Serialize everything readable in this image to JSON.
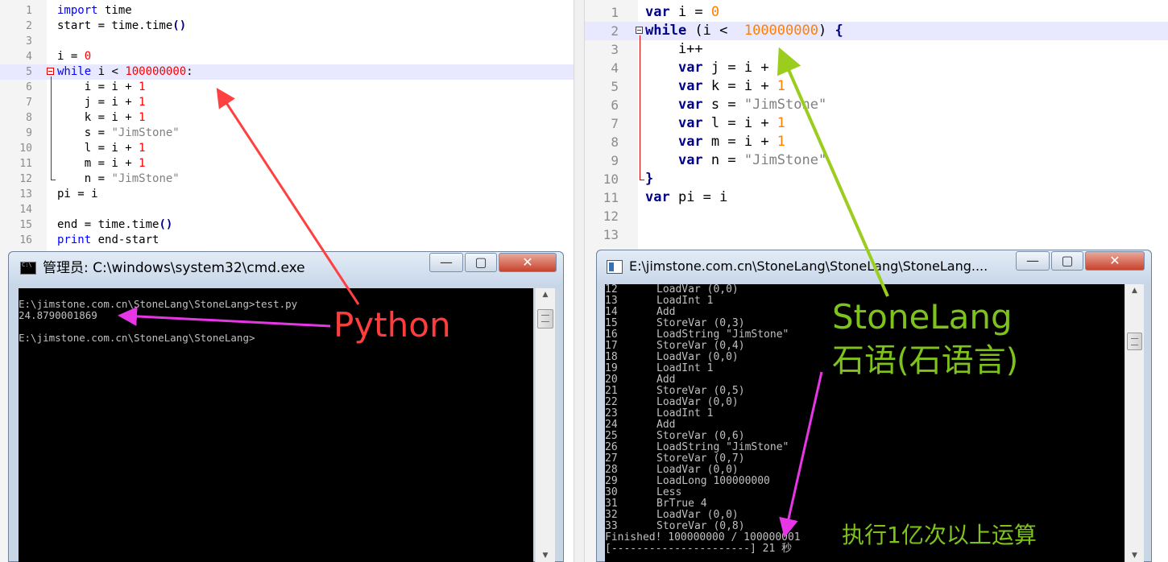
{
  "colors": {
    "python_label": "#ff3d3d",
    "stonelang_label": "#7ec21c",
    "magenta_arrow": "#e636e6",
    "green_arrow": "#9acd1e",
    "red_arrow": "#ff4040",
    "current_line_highlight": "#e8e8ff"
  },
  "python_editor": {
    "lines": [
      {
        "num": "1",
        "tokens": [
          {
            "t": "import",
            "c": "kw"
          },
          {
            "t": " time",
            "c": "plain"
          }
        ]
      },
      {
        "num": "2",
        "tokens": [
          {
            "t": "start = time.time",
            "c": "plain"
          },
          {
            "t": "()",
            "c": "op"
          }
        ]
      },
      {
        "num": "3",
        "tokens": []
      },
      {
        "num": "4",
        "tokens": [
          {
            "t": "i = ",
            "c": "plain"
          },
          {
            "t": "0",
            "c": "num"
          }
        ]
      },
      {
        "num": "5",
        "tokens": [
          {
            "t": "while",
            "c": "kw"
          },
          {
            "t": " i < ",
            "c": "plain"
          },
          {
            "t": "100000000",
            "c": "num"
          },
          {
            "t": ":",
            "c": "plain"
          }
        ]
      },
      {
        "num": "6",
        "tokens": [
          {
            "t": "    i = i + ",
            "c": "plain"
          },
          {
            "t": "1",
            "c": "num"
          }
        ]
      },
      {
        "num": "7",
        "tokens": [
          {
            "t": "    j = i + ",
            "c": "plain"
          },
          {
            "t": "1",
            "c": "num"
          }
        ]
      },
      {
        "num": "8",
        "tokens": [
          {
            "t": "    k = i + ",
            "c": "plain"
          },
          {
            "t": "1",
            "c": "num"
          }
        ]
      },
      {
        "num": "9",
        "tokens": [
          {
            "t": "    s = ",
            "c": "plain"
          },
          {
            "t": "\"JimStone\"",
            "c": "str"
          }
        ]
      },
      {
        "num": "10",
        "tokens": [
          {
            "t": "    l = i + ",
            "c": "plain"
          },
          {
            "t": "1",
            "c": "num"
          }
        ]
      },
      {
        "num": "11",
        "tokens": [
          {
            "t": "    m = i + ",
            "c": "plain"
          },
          {
            "t": "1",
            "c": "num"
          }
        ]
      },
      {
        "num": "12",
        "tokens": [
          {
            "t": "    n = ",
            "c": "plain"
          },
          {
            "t": "\"JimStone\"",
            "c": "str"
          }
        ]
      },
      {
        "num": "13",
        "tokens": [
          {
            "t": "pi = i",
            "c": "plain"
          }
        ]
      },
      {
        "num": "14",
        "tokens": []
      },
      {
        "num": "15",
        "tokens": [
          {
            "t": "end = time.time",
            "c": "plain"
          },
          {
            "t": "()",
            "c": "op"
          }
        ]
      },
      {
        "num": "16",
        "tokens": [
          {
            "t": "print",
            "c": "kw"
          },
          {
            "t": " end-start",
            "c": "plain"
          }
        ]
      }
    ]
  },
  "stonelang_editor": {
    "lines": [
      {
        "num": "1",
        "tokens": [
          {
            "t": "var",
            "c": "kwb"
          },
          {
            "t": " i = ",
            "c": "plain"
          },
          {
            "t": "0",
            "c": "numo"
          }
        ]
      },
      {
        "num": "2",
        "tokens": [
          {
            "t": "while",
            "c": "kwb"
          },
          {
            "t": " (i <  ",
            "c": "plain"
          },
          {
            "t": "100000000",
            "c": "numo"
          },
          {
            "t": ") ",
            "c": "plain"
          },
          {
            "t": "{",
            "c": "op"
          }
        ]
      },
      {
        "num": "3",
        "tokens": [
          {
            "t": "    i++",
            "c": "plain"
          }
        ]
      },
      {
        "num": "4",
        "tokens": [
          {
            "t": "    ",
            "c": "plain"
          },
          {
            "t": "var",
            "c": "kwb"
          },
          {
            "t": " j = i + ",
            "c": "plain"
          },
          {
            "t": "1",
            "c": "numo"
          }
        ]
      },
      {
        "num": "5",
        "tokens": [
          {
            "t": "    ",
            "c": "plain"
          },
          {
            "t": "var",
            "c": "kwb"
          },
          {
            "t": " k = i + ",
            "c": "plain"
          },
          {
            "t": "1",
            "c": "numo"
          }
        ]
      },
      {
        "num": "6",
        "tokens": [
          {
            "t": "    ",
            "c": "plain"
          },
          {
            "t": "var",
            "c": "kwb"
          },
          {
            "t": " s = ",
            "c": "plain"
          },
          {
            "t": "\"JimStone\"",
            "c": "str"
          }
        ]
      },
      {
        "num": "7",
        "tokens": [
          {
            "t": "    ",
            "c": "plain"
          },
          {
            "t": "var",
            "c": "kwb"
          },
          {
            "t": " l = i + ",
            "c": "plain"
          },
          {
            "t": "1",
            "c": "numo"
          }
        ]
      },
      {
        "num": "8",
        "tokens": [
          {
            "t": "    ",
            "c": "plain"
          },
          {
            "t": "var",
            "c": "kwb"
          },
          {
            "t": " m = i + ",
            "c": "plain"
          },
          {
            "t": "1",
            "c": "numo"
          }
        ]
      },
      {
        "num": "9",
        "tokens": [
          {
            "t": "    ",
            "c": "plain"
          },
          {
            "t": "var",
            "c": "kwb"
          },
          {
            "t": " n = ",
            "c": "plain"
          },
          {
            "t": "\"JimStone\"",
            "c": "str"
          }
        ]
      },
      {
        "num": "10",
        "tokens": [
          {
            "t": "}",
            "c": "op"
          }
        ]
      },
      {
        "num": "11",
        "tokens": [
          {
            "t": "var",
            "c": "kwb"
          },
          {
            "t": " pi = i",
            "c": "plain"
          }
        ]
      },
      {
        "num": "12",
        "tokens": []
      },
      {
        "num": "13",
        "tokens": []
      }
    ]
  },
  "cmd_window": {
    "title": "管理员: C:\\windows\\system32\\cmd.exe",
    "minimize_label": "—",
    "maximize_label": "▢",
    "close_label": "✕",
    "output": [
      "E:\\jimstone.com.cn\\StoneLang\\StoneLang>test.py",
      "24.8790001869",
      "",
      "E:\\jimstone.com.cn\\StoneLang\\StoneLang>"
    ]
  },
  "stonelang_window": {
    "title": "E:\\jimstone.com.cn\\StoneLang\\StoneLang\\StoneLang....",
    "minimize_label": "—",
    "maximize_label": "▢",
    "close_label": "✕",
    "bytecode": [
      {
        "num": "12",
        "op": "LoadVar (0,0)"
      },
      {
        "num": "13",
        "op": "LoadInt 1"
      },
      {
        "num": "14",
        "op": "Add"
      },
      {
        "num": "15",
        "op": "StoreVar (0,3)"
      },
      {
        "num": "16",
        "op": "LoadString \"JimStone\""
      },
      {
        "num": "17",
        "op": "StoreVar (0,4)"
      },
      {
        "num": "18",
        "op": "LoadVar (0,0)"
      },
      {
        "num": "19",
        "op": "LoadInt 1"
      },
      {
        "num": "20",
        "op": "Add"
      },
      {
        "num": "21",
        "op": "StoreVar (0,5)"
      },
      {
        "num": "22",
        "op": "LoadVar (0,0)"
      },
      {
        "num": "23",
        "op": "LoadInt 1"
      },
      {
        "num": "24",
        "op": "Add"
      },
      {
        "num": "25",
        "op": "StoreVar (0,6)"
      },
      {
        "num": "26",
        "op": "LoadString \"JimStone\""
      },
      {
        "num": "27",
        "op": "StoreVar (0,7)"
      },
      {
        "num": "28",
        "op": "LoadVar (0,0)"
      },
      {
        "num": "29",
        "op": "LoadLong 100000000"
      },
      {
        "num": "30",
        "op": "Less"
      },
      {
        "num": "31",
        "op": "BrTrue 4"
      },
      {
        "num": "32",
        "op": "LoadVar (0,0)"
      },
      {
        "num": "33",
        "op": "StoreVar (0,8)"
      }
    ],
    "finished_line": "Finished! 100000000 / 100000001",
    "progress_line": "[----------------------] 21 秒"
  },
  "annotations": {
    "python_label": "Python",
    "stonelang_label": "StoneLang",
    "stonelang_cn_label": "石语(石语言)",
    "ops_note": "执行1亿次以上运算"
  }
}
